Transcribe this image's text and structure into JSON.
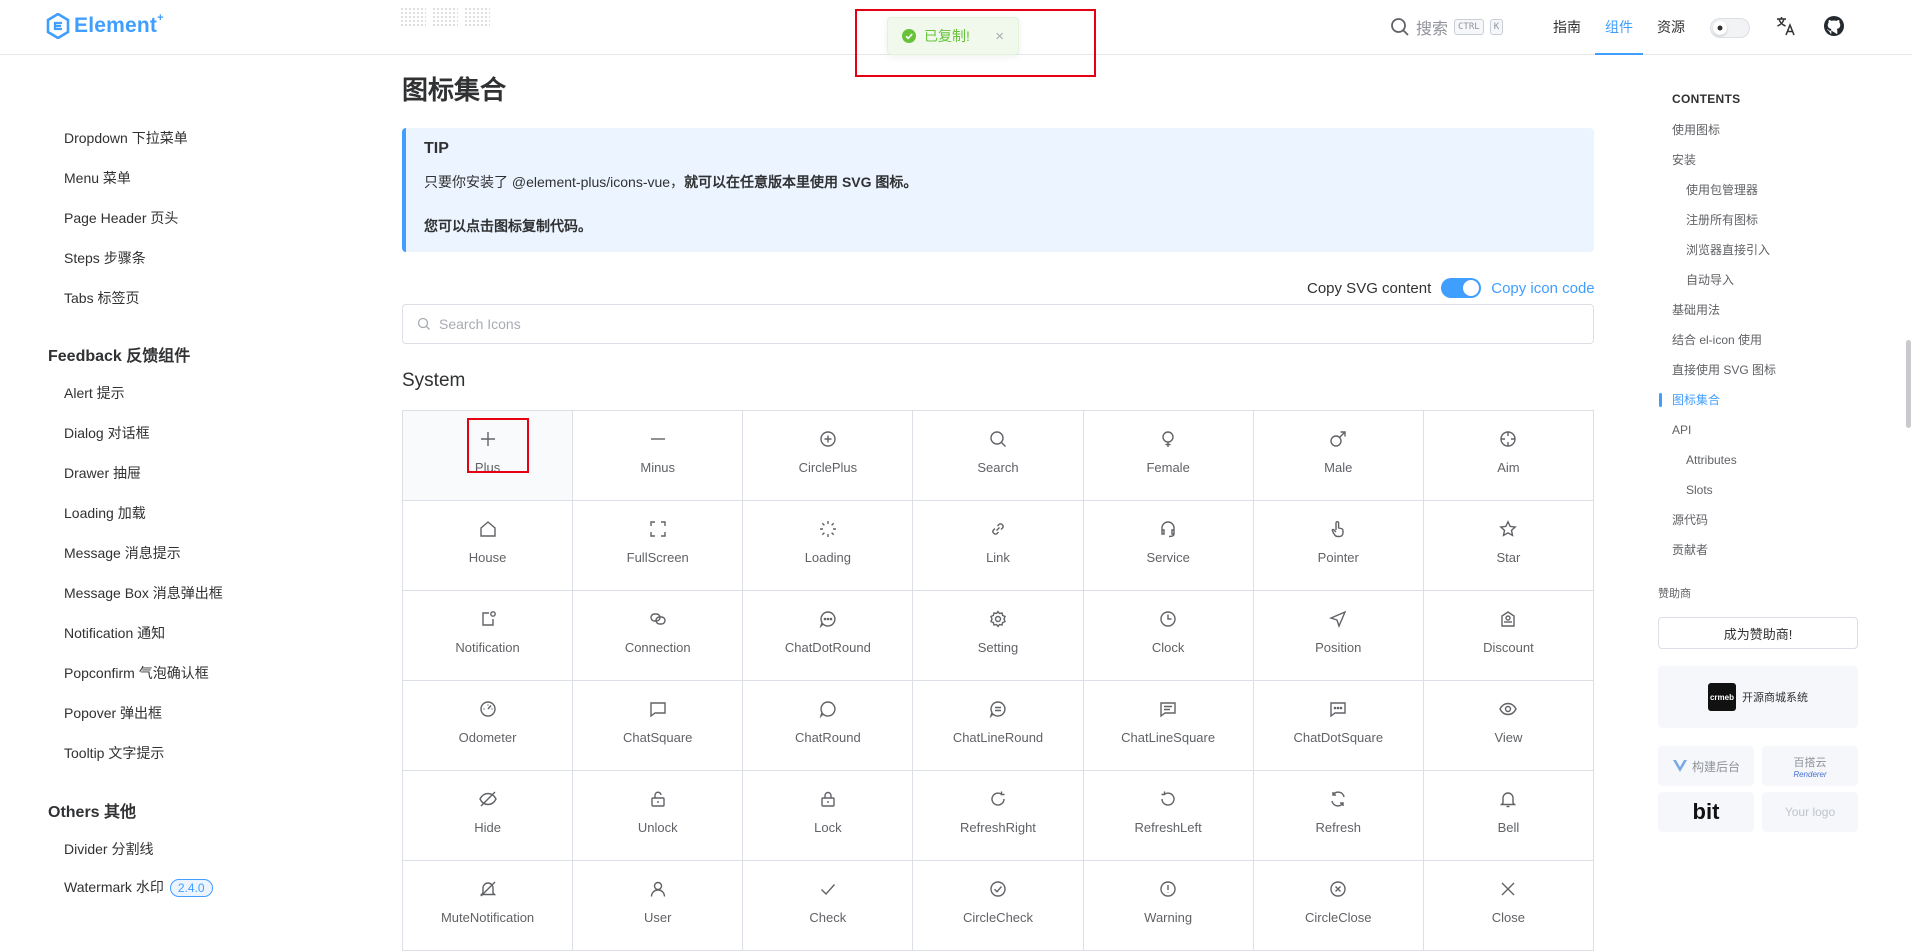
{
  "header": {
    "logo": "Element",
    "logo_sup": "+",
    "search_label": "搜索",
    "kbd_ctrl": "CTRL",
    "kbd_k": "K",
    "nav": [
      "指南",
      "组件",
      "资源"
    ],
    "active_nav": "组件"
  },
  "toast": {
    "text": "已复制!",
    "close": "×"
  },
  "sidebar": {
    "items_a": [
      "Dropdown 下拉菜单",
      "Menu 菜单",
      "Page Header 页头",
      "Steps 步骤条",
      "Tabs 标签页"
    ],
    "group_feedback": "Feedback 反馈组件",
    "items_b": [
      "Alert 提示",
      "Dialog 对话框",
      "Drawer 抽屉",
      "Loading 加载",
      "Message 消息提示",
      "Message Box 消息弹出框",
      "Notification 通知",
      "Popconfirm 气泡确认框",
      "Popover 弹出框",
      "Tooltip 文字提示"
    ],
    "group_others": "Others 其他",
    "items_c": [
      "Divider 分割线",
      "Watermark 水印"
    ],
    "watermark_badge": "2.4.0"
  },
  "main": {
    "title": "图标集合",
    "tip": {
      "title": "TIP",
      "line1_normal": "只要你安装了 @element-plus/icons-vue，",
      "line1_bold": "就可以在任意版本里使用 SVG 图标。",
      "line2": "您可以点击图标复制代码。"
    },
    "copy_svg_label": "Copy SVG content",
    "copy_icon_label": "Copy icon code",
    "search_placeholder": "Search Icons",
    "section": "System",
    "icons": [
      {
        "name": "Plus",
        "icon": "plus-icon"
      },
      {
        "name": "Minus",
        "icon": "minus-icon"
      },
      {
        "name": "CirclePlus",
        "icon": "circle-plus-icon"
      },
      {
        "name": "Search",
        "icon": "search-icon"
      },
      {
        "name": "Female",
        "icon": "female-icon"
      },
      {
        "name": "Male",
        "icon": "male-icon"
      },
      {
        "name": "Aim",
        "icon": "aim-icon"
      },
      {
        "name": "House",
        "icon": "house-icon"
      },
      {
        "name": "FullScreen",
        "icon": "fullscreen-icon"
      },
      {
        "name": "Loading",
        "icon": "loading-icon"
      },
      {
        "name": "Link",
        "icon": "link-icon"
      },
      {
        "name": "Service",
        "icon": "service-icon"
      },
      {
        "name": "Pointer",
        "icon": "pointer-icon"
      },
      {
        "name": "Star",
        "icon": "star-icon"
      },
      {
        "name": "Notification",
        "icon": "notification-icon"
      },
      {
        "name": "Connection",
        "icon": "connection-icon"
      },
      {
        "name": "ChatDotRound",
        "icon": "chat-dot-round-icon"
      },
      {
        "name": "Setting",
        "icon": "setting-icon"
      },
      {
        "name": "Clock",
        "icon": "clock-icon"
      },
      {
        "name": "Position",
        "icon": "position-icon"
      },
      {
        "name": "Discount",
        "icon": "discount-icon"
      },
      {
        "name": "Odometer",
        "icon": "odometer-icon"
      },
      {
        "name": "ChatSquare",
        "icon": "chat-square-icon"
      },
      {
        "name": "ChatRound",
        "icon": "chat-round-icon"
      },
      {
        "name": "ChatLineRound",
        "icon": "chat-line-round-icon"
      },
      {
        "name": "ChatLineSquare",
        "icon": "chat-line-square-icon"
      },
      {
        "name": "ChatDotSquare",
        "icon": "chat-dot-square-icon"
      },
      {
        "name": "View",
        "icon": "view-icon"
      },
      {
        "name": "Hide",
        "icon": "hide-icon"
      },
      {
        "name": "Unlock",
        "icon": "unlock-icon"
      },
      {
        "name": "Lock",
        "icon": "lock-icon"
      },
      {
        "name": "RefreshRight",
        "icon": "refresh-right-icon"
      },
      {
        "name": "RefreshLeft",
        "icon": "refresh-left-icon"
      },
      {
        "name": "Refresh",
        "icon": "refresh-icon"
      },
      {
        "name": "Bell",
        "icon": "bell-icon"
      },
      {
        "name": "MuteNotification",
        "icon": "mute-notification-icon"
      },
      {
        "name": "User",
        "icon": "user-icon"
      },
      {
        "name": "Check",
        "icon": "check-icon"
      },
      {
        "name": "CircleCheck",
        "icon": "circle-check-icon"
      },
      {
        "name": "Warning",
        "icon": "warning-icon"
      },
      {
        "name": "CircleClose",
        "icon": "circle-close-icon"
      },
      {
        "name": "Close",
        "icon": "close-icon"
      }
    ]
  },
  "toc": {
    "title": "CONTENTS",
    "items": [
      {
        "label": "使用图标",
        "sub": false
      },
      {
        "label": "安装",
        "sub": false
      },
      {
        "label": "使用包管理器",
        "sub": true
      },
      {
        "label": "注册所有图标",
        "sub": true
      },
      {
        "label": "浏览器直接引入",
        "sub": true
      },
      {
        "label": "自动导入",
        "sub": true
      },
      {
        "label": "基础用法",
        "sub": false
      },
      {
        "label": "结合 el-icon 使用",
        "sub": false
      },
      {
        "label": "直接使用 SVG 图标",
        "sub": false
      },
      {
        "label": "图标集合",
        "sub": false,
        "active": true
      },
      {
        "label": "API",
        "sub": false
      },
      {
        "label": "Attributes",
        "sub": true
      },
      {
        "label": "Slots",
        "sub": true
      },
      {
        "label": "源代码",
        "sub": false
      },
      {
        "label": "贡献者",
        "sub": false
      }
    ]
  },
  "sponsors": {
    "label": "赞助商",
    "button": "成为赞助商!",
    "main_logo_text": "crmeb",
    "main_text": "开源商城系统",
    "tiles": [
      "构建后台",
      "百搭云",
      "bit",
      "Your logo"
    ],
    "tile_sub": "Renderer"
  },
  "colors": {
    "accent": "#409eff",
    "success": "#67c23a",
    "highlight_box": "#e60012"
  }
}
